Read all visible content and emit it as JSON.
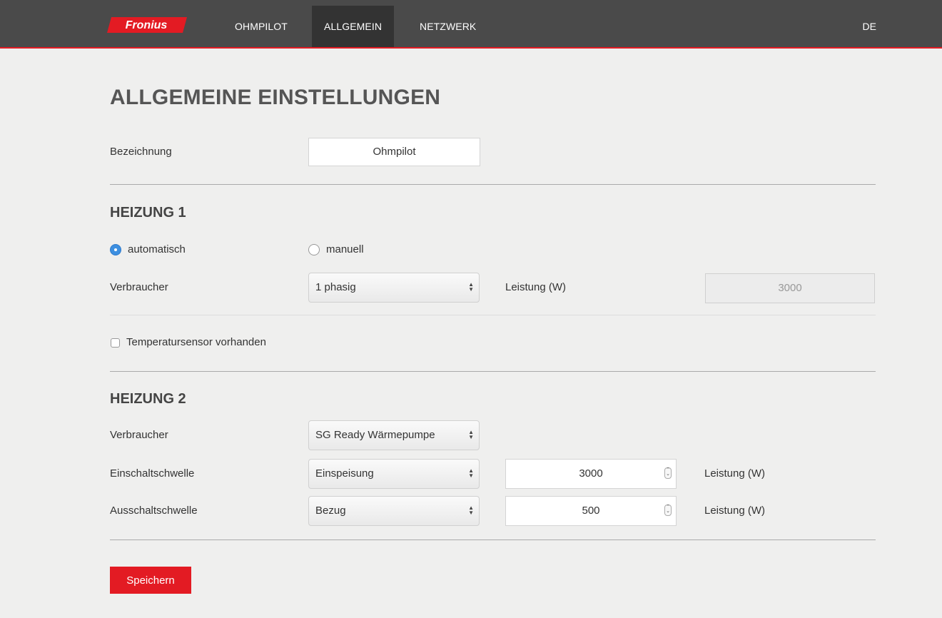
{
  "nav": {
    "brand": "Fronius",
    "items": [
      "OHMPILOT",
      "ALLGEMEIN",
      "NETZWERK"
    ],
    "active": "ALLGEMEIN",
    "language": "DE"
  },
  "page_title": "ALLGEMEINE EINSTELLUNGEN",
  "designation": {
    "label": "Bezeichnung",
    "value": "Ohmpilot"
  },
  "heating1": {
    "title": "HEIZUNG 1",
    "mode_auto_label": "automatisch",
    "mode_manual_label": "manuell",
    "selected_mode": "automatisch",
    "consumer_label": "Verbraucher",
    "consumer_value": "1 phasig",
    "power_label": "Leistung (W)",
    "power_value": "3000",
    "temp_sensor_label": "Temperatursensor vorhanden",
    "temp_sensor_checked": false
  },
  "heating2": {
    "title": "HEIZUNG 2",
    "consumer_label": "Verbraucher",
    "consumer_value": "SG Ready Wärmepumpe",
    "on_threshold_label": "Einschaltschwelle",
    "on_threshold_mode": "Einspeisung",
    "on_threshold_value": "3000",
    "off_threshold_label": "Ausschaltschwelle",
    "off_threshold_mode": "Bezug",
    "off_threshold_value": "500",
    "power_label": "Leistung (W)"
  },
  "save_label": "Speichern",
  "colors": {
    "accent": "#e31b23",
    "topbar": "#4a4a4a",
    "radio": "#3d8fe0"
  }
}
